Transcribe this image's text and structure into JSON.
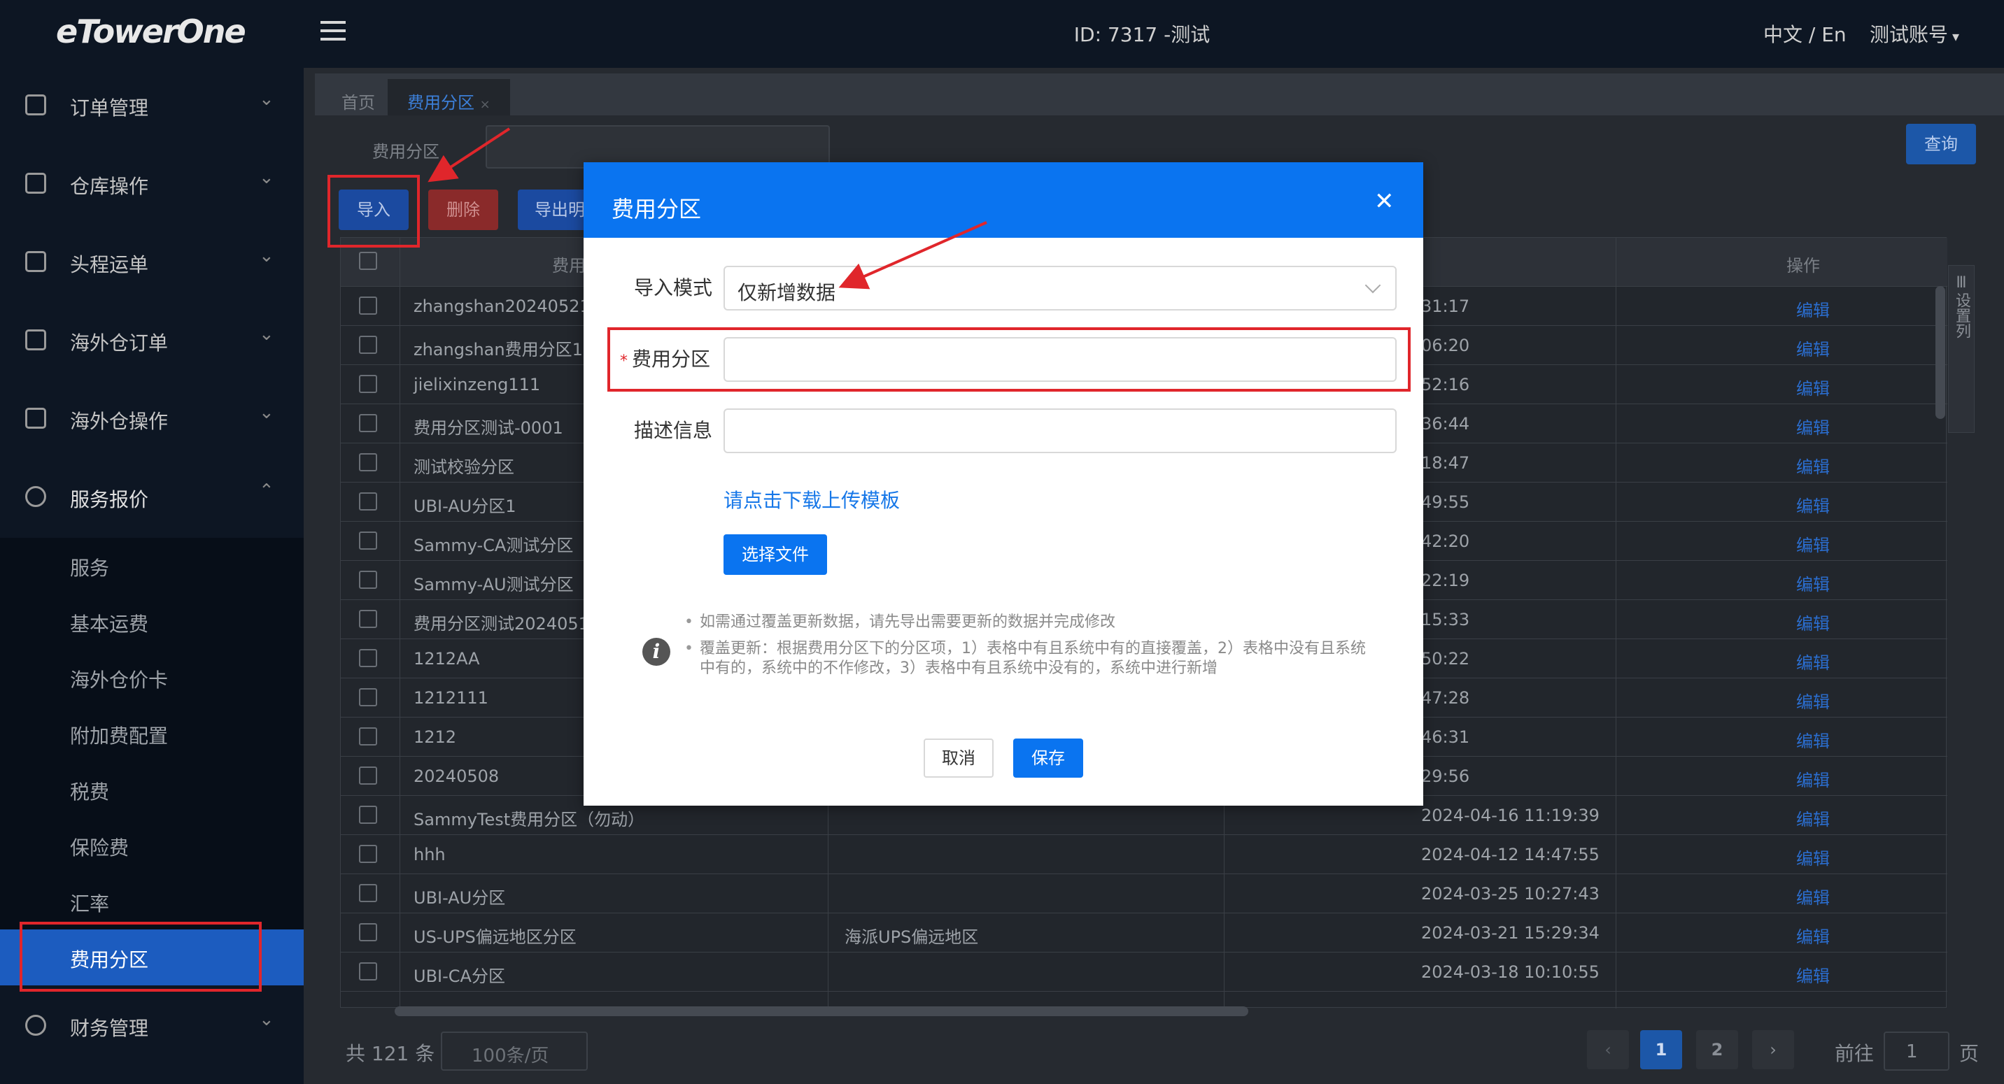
{
  "app": {
    "logo": "eTowerOne",
    "title": "ID: 7317 -测试",
    "lang": "中文 / En",
    "user": "测试账号"
  },
  "sidebar": {
    "groups": [
      {
        "label": "订单管理",
        "icon": "order-icon"
      },
      {
        "label": "仓库操作",
        "icon": "warehouse-icon"
      },
      {
        "label": "头程运单",
        "icon": "waybill-icon"
      },
      {
        "label": "海外仓订单",
        "icon": "overseas-order-icon"
      },
      {
        "label": "海外仓操作",
        "icon": "overseas-ops-icon"
      },
      {
        "label": "服务报价",
        "icon": "service-quote-icon"
      }
    ],
    "subitems": [
      "服务",
      "基本运费",
      "海外仓价卡",
      "附加费配置",
      "税费",
      "保险费",
      "汇率",
      "费用分区"
    ],
    "finance": "财务管理"
  },
  "tabs": [
    "首页",
    "费用分区"
  ],
  "search": {
    "label": "费用分区",
    "query": "查询"
  },
  "toolbar": {
    "import": "导入",
    "delete": "删除",
    "export": "导出明"
  },
  "table": {
    "headers": {
      "name": "费用",
      "op": "操作"
    },
    "rows": [
      {
        "name": "zhangshan20240521",
        "desc": "",
        "time": "31:17"
      },
      {
        "name": "zhangshan费用分区1",
        "desc": "",
        "time": "06:20"
      },
      {
        "name": "jielixinzeng111",
        "desc": "",
        "time": "52:16"
      },
      {
        "name": "费用分区测试-0001",
        "desc": "",
        "time": "36:44"
      },
      {
        "name": "测试校验分区",
        "desc": "",
        "time": "18:47"
      },
      {
        "name": "UBI-AU分区1",
        "desc": "",
        "time": "49:55"
      },
      {
        "name": "Sammy-CA测试分区（",
        "desc": "",
        "time": "42:20"
      },
      {
        "name": "Sammy-AU测试分区（",
        "desc": "",
        "time": "22:19"
      },
      {
        "name": "费用分区测试2024051",
        "desc": "",
        "time": "15:33"
      },
      {
        "name": "1212AA",
        "desc": "",
        "time": "50:22"
      },
      {
        "name": "1212111",
        "desc": "",
        "time": "47:28"
      },
      {
        "name": "1212",
        "desc": "",
        "time": "46:31"
      },
      {
        "name": "20240508",
        "desc": "",
        "time": "29:56"
      },
      {
        "name": "SammyTest费用分区（勿动）",
        "desc": "",
        "time": "2024-04-16 11:19:39"
      },
      {
        "name": "hhh",
        "desc": "",
        "time": "2024-04-12 14:47:55"
      },
      {
        "name": "UBI-AU分区",
        "desc": "",
        "time": "2024-03-25 10:27:43"
      },
      {
        "name": "US-UPS偏远地区分区",
        "desc": "海派UPS偏远地区",
        "time": "2024-03-21 15:29:34"
      },
      {
        "name": "UBI-CA分区",
        "desc": "",
        "time": "2024-03-18 10:10:55"
      }
    ],
    "edit": "编辑",
    "settings": "设置列"
  },
  "pagination": {
    "total": "共 121 条",
    "page_size": "100条/页",
    "pages": [
      "1",
      "2"
    ],
    "goto": "前往",
    "goto_value": "1",
    "page_unit": "页"
  },
  "modal": {
    "title": "费用分区",
    "mode_label": "导入模式",
    "mode_value": "仅新增数据",
    "zone_label": "费用分区",
    "zone_value": "",
    "desc_label": "描述信息",
    "desc_value": "",
    "template_link": "请点击下载上传模板",
    "choose_file": "选择文件",
    "note1": "如需通过覆盖更新数据，请先导出需要更新的数据并完成修改",
    "note2": "覆盖更新：根据费用分区下的分区项，1）表格中有且系统中有的直接覆盖，2）表格中没有且系统中有的，系统中的不作修改，3）表格中有且系统中没有的，系统中进行新增",
    "cancel": "取消",
    "save": "保存"
  },
  "colors": {
    "accent": "#0a74f0",
    "annotation": "#e0262b",
    "sidebar": "#0d1623"
  }
}
